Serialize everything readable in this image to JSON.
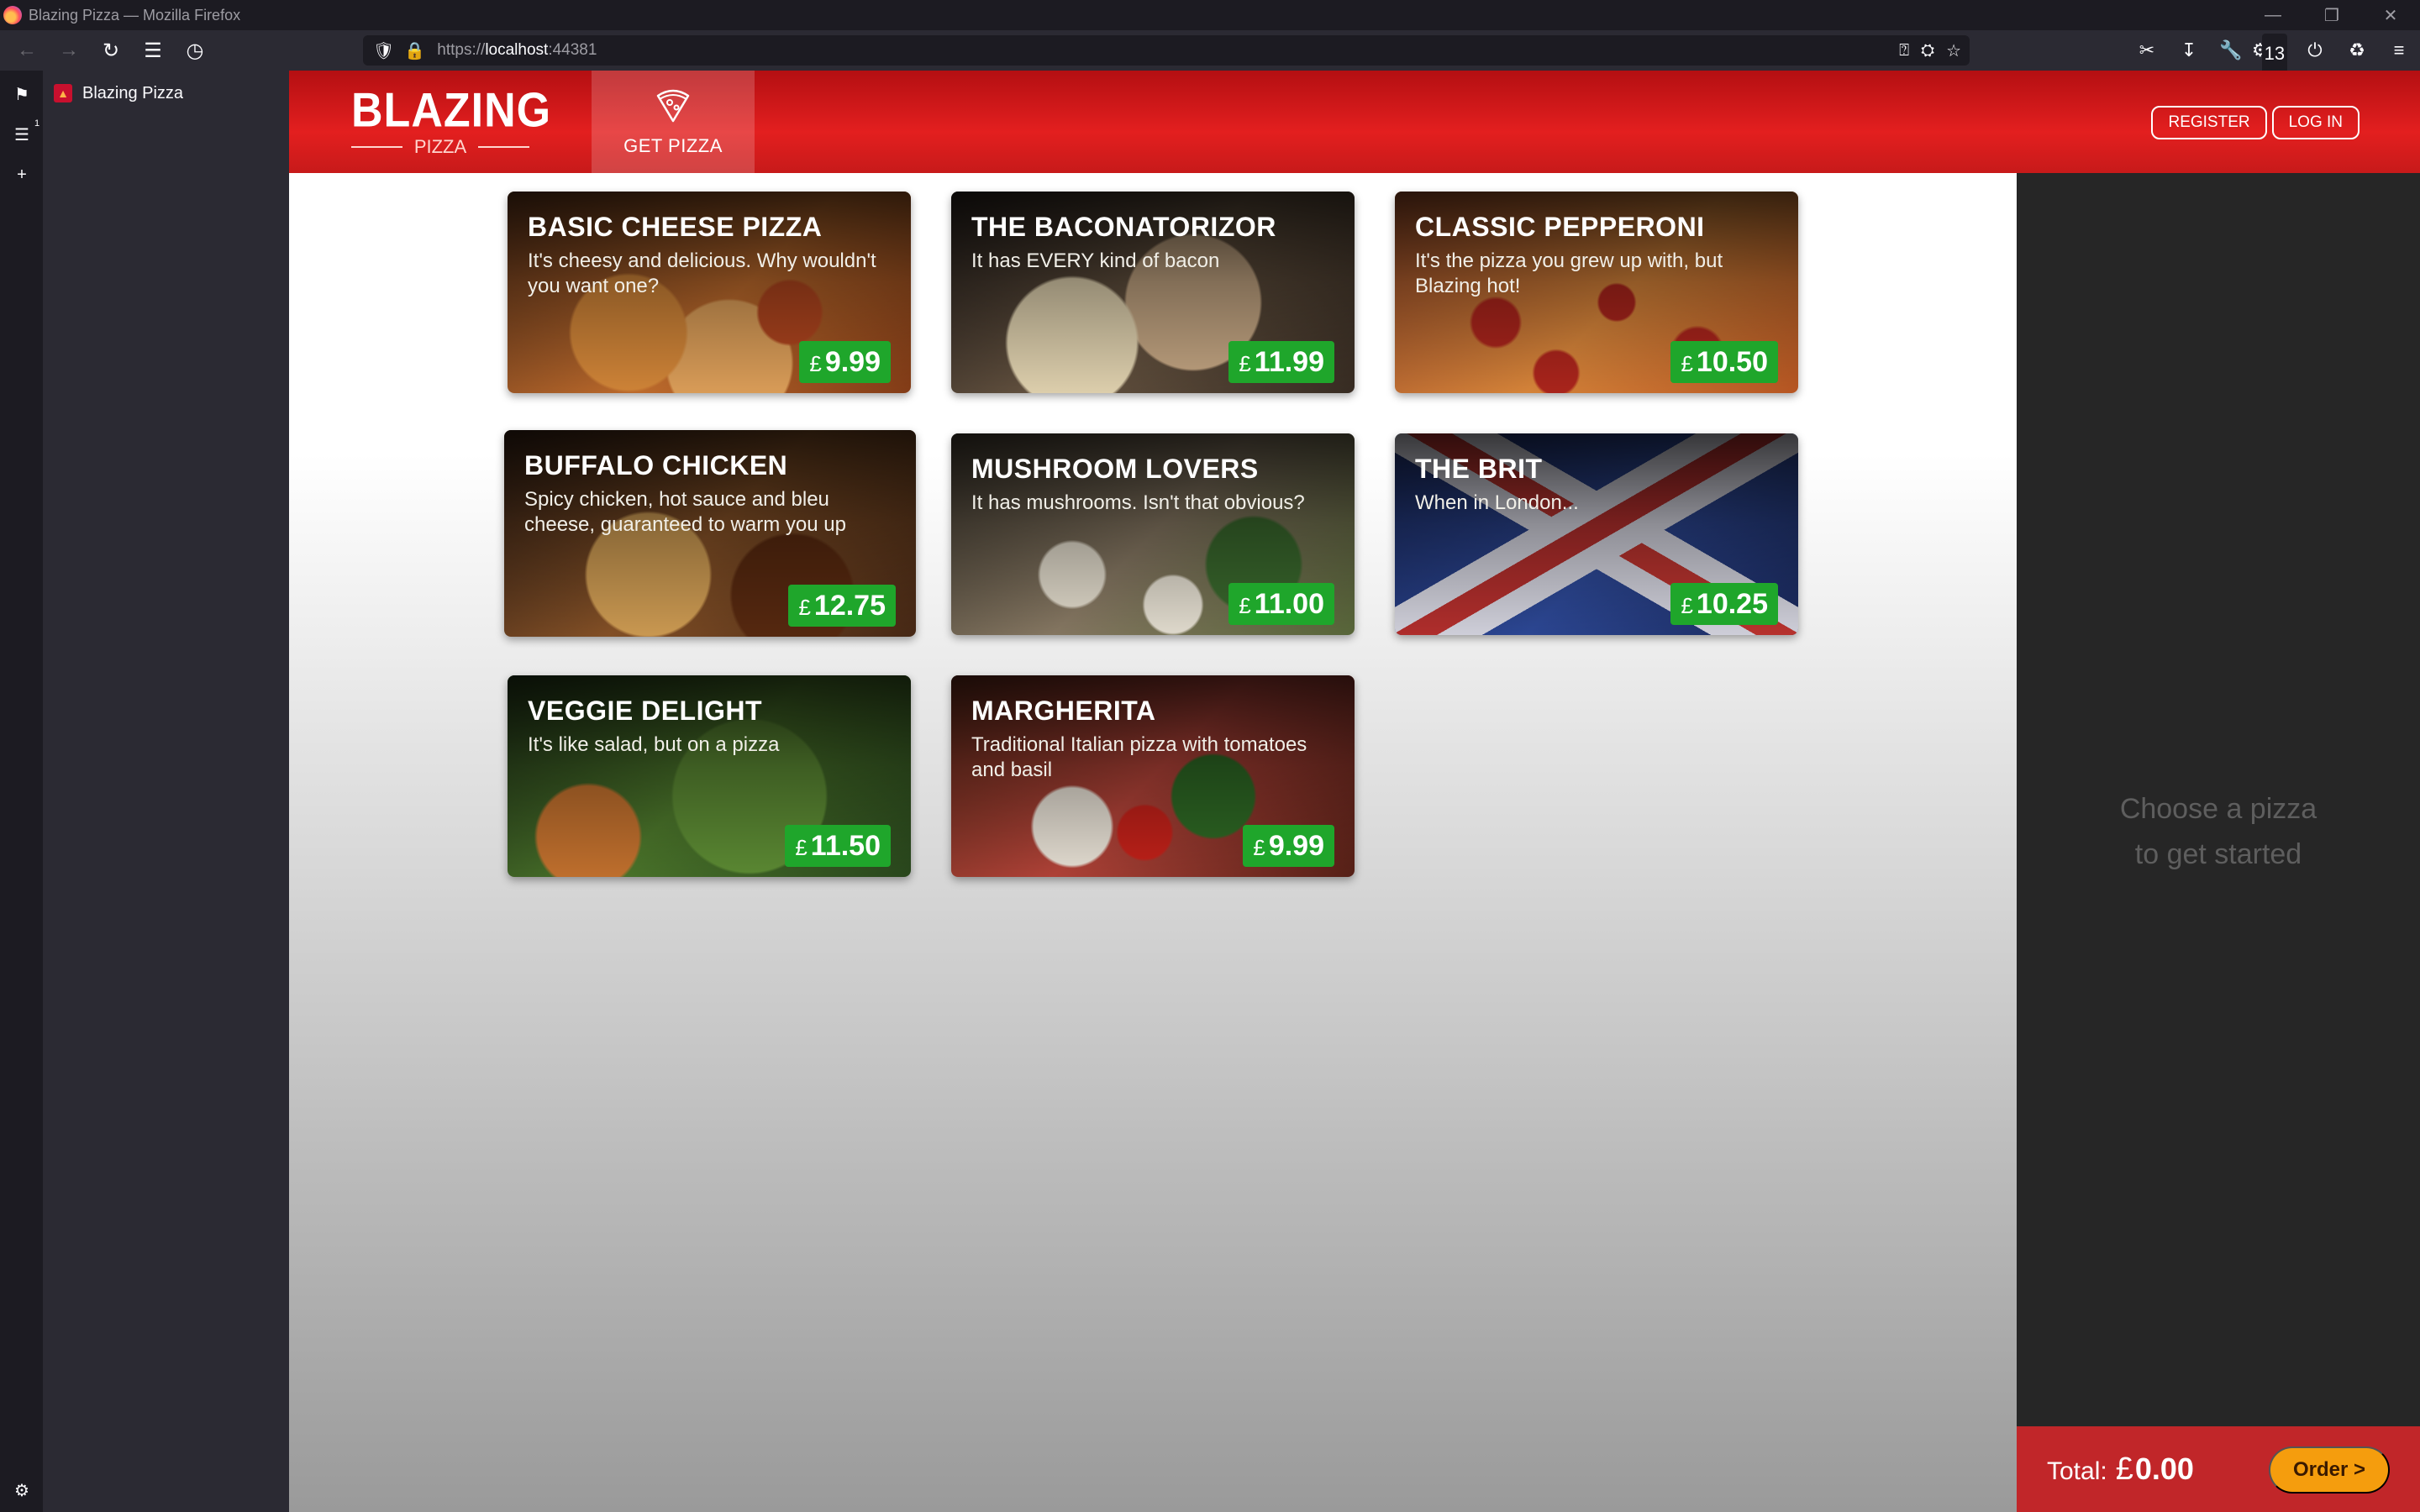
{
  "browser": {
    "window_title": "Blazing Pizza — Mozilla Firefox",
    "url_scheme": "https://",
    "url_host": "localhost",
    "url_port": ":44381",
    "extensions_badge": "13",
    "vertical_tabs_badge": "1"
  },
  "sidebar": {
    "tab_title": "Blazing Pizza"
  },
  "app": {
    "logo_main": "BLAZING",
    "logo_sub": "PIZZA",
    "nav_tab_label": "GET PIZZA",
    "register_label": "REGISTER",
    "login_label": "LOG IN"
  },
  "specials": [
    {
      "name": "BASIC CHEESE PIZZA",
      "description": "It's cheesy and delicious. Why wouldn't you want one?",
      "currency": "£",
      "price": "9.99"
    },
    {
      "name": "THE BACONATORIZOR",
      "description": "It has EVERY kind of bacon",
      "currency": "£",
      "price": "11.99"
    },
    {
      "name": "CLASSIC PEPPERONI",
      "description": "It's the pizza you grew up with, but Blazing hot!",
      "currency": "£",
      "price": "10.50"
    },
    {
      "name": "BUFFALO CHICKEN",
      "description": "Spicy chicken, hot sauce and bleu cheese, guaranteed to warm you up",
      "currency": "£",
      "price": "12.75"
    },
    {
      "name": "MUSHROOM LOVERS",
      "description": "It has mushrooms. Isn't that obvious?",
      "currency": "£",
      "price": "11.00"
    },
    {
      "name": "THE BRIT",
      "description": "When in London...",
      "currency": "£",
      "price": "10.25"
    },
    {
      "name": "VEGGIE DELIGHT",
      "description": "It's like salad, but on a pizza",
      "currency": "£",
      "price": "11.50"
    },
    {
      "name": "MARGHERITA",
      "description": "Traditional Italian pizza with tomatoes and basil",
      "currency": "£",
      "price": "9.99"
    }
  ],
  "order": {
    "empty_line1": "Choose a pizza",
    "empty_line2": "to get started",
    "total_label": "Total:",
    "currency": "£",
    "total": "0.00",
    "order_button": "Order >"
  },
  "colors": {
    "brand_red": "#c8161c",
    "price_green": "#1fa62b",
    "order_button": "#f59d0d"
  }
}
